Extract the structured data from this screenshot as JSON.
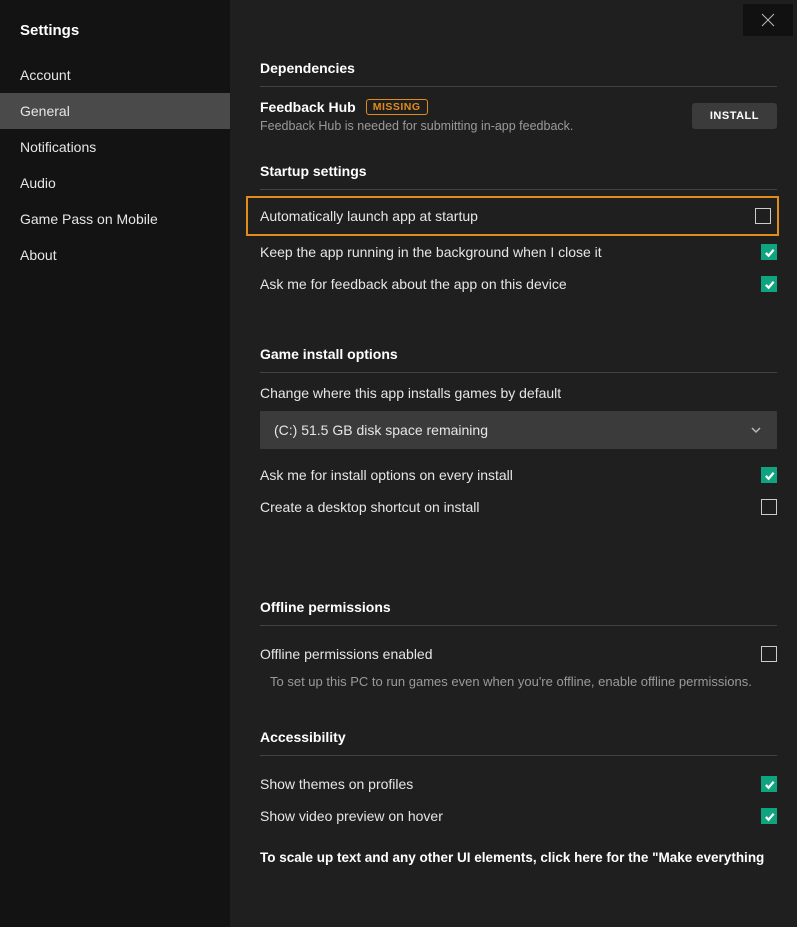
{
  "sidebar": {
    "title": "Settings",
    "items": [
      {
        "label": "Account"
      },
      {
        "label": "General"
      },
      {
        "label": "Notifications"
      },
      {
        "label": "Audio"
      },
      {
        "label": "Game Pass on Mobile"
      },
      {
        "label": "About"
      }
    ]
  },
  "sections": {
    "dependencies": {
      "title": "Dependencies",
      "feedback_hub": {
        "name": "Feedback Hub",
        "badge": "MISSING",
        "desc": "Feedback Hub is needed for submitting in-app feedback.",
        "install": "INSTALL"
      }
    },
    "startup": {
      "title": "Startup settings",
      "auto_launch": "Automatically launch app at startup",
      "keep_running": "Keep the app running in the background when I close it",
      "ask_feedback": "Ask me for feedback about the app on this device"
    },
    "install": {
      "title": "Game install options",
      "change_where": "Change where this app installs games by default",
      "dropdown_value": "(C:) 51.5 GB disk space remaining",
      "ask_options": "Ask me for install options on every install",
      "create_shortcut": "Create a desktop shortcut on install"
    },
    "offline": {
      "title": "Offline permissions",
      "enabled": "Offline permissions enabled",
      "desc": "To set up this PC to run games even when you're offline, enable offline permissions."
    },
    "accessibility": {
      "title": "Accessibility",
      "themes": "Show themes on profiles",
      "video_preview": "Show video preview on hover",
      "scale_note": "To scale up text and any other UI elements, click here for the \"Make everything"
    }
  }
}
